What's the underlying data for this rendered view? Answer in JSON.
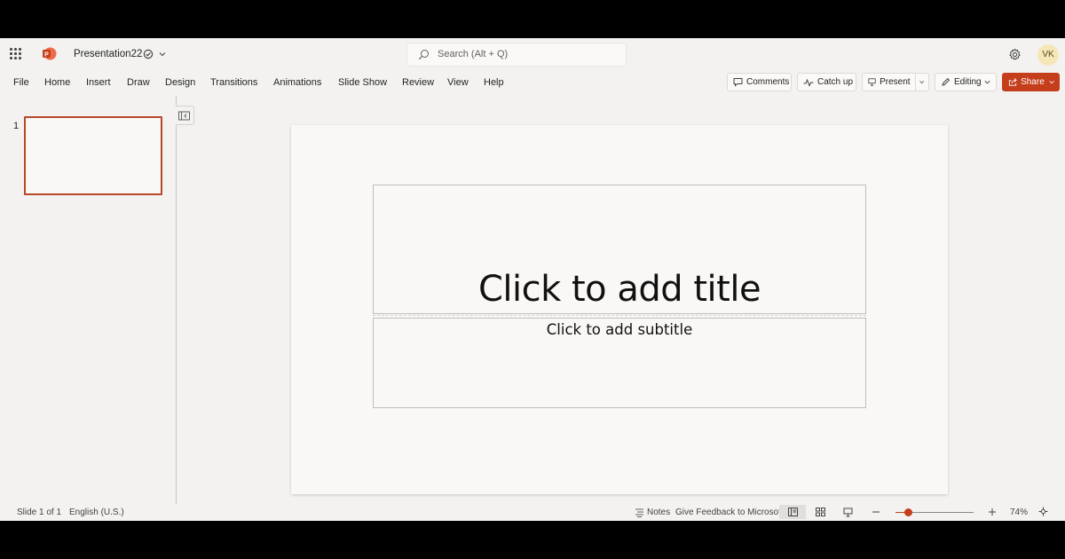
{
  "app": {
    "document_title": "Presentation22",
    "search_placeholder": "Search (Alt + Q)",
    "user_initials": "VK"
  },
  "ribbon": {
    "tabs": [
      "File",
      "Home",
      "Insert",
      "Draw",
      "Design",
      "Transitions",
      "Animations",
      "Slide Show",
      "Review",
      "View",
      "Help"
    ],
    "comments_label": "Comments",
    "catchup_label": "Catch up",
    "present_label": "Present",
    "editing_label": "Editing",
    "share_label": "Share"
  },
  "thumbnails": {
    "slides": [
      {
        "number": "1"
      }
    ]
  },
  "slide": {
    "title_placeholder": "Click to add title",
    "subtitle_placeholder": "Click to add subtitle"
  },
  "status": {
    "slide_counter": "Slide 1 of 1",
    "language": "English (U.S.)",
    "notes_label": "Notes",
    "feedback_label": "Give Feedback to Microsoft",
    "zoom_level": "74%"
  },
  "colors": {
    "accent": "#c43e1c",
    "thumbnail_selected_border": "#b7472a",
    "app_background": "#f3f2f1",
    "slide_background": "#faf8f6"
  }
}
